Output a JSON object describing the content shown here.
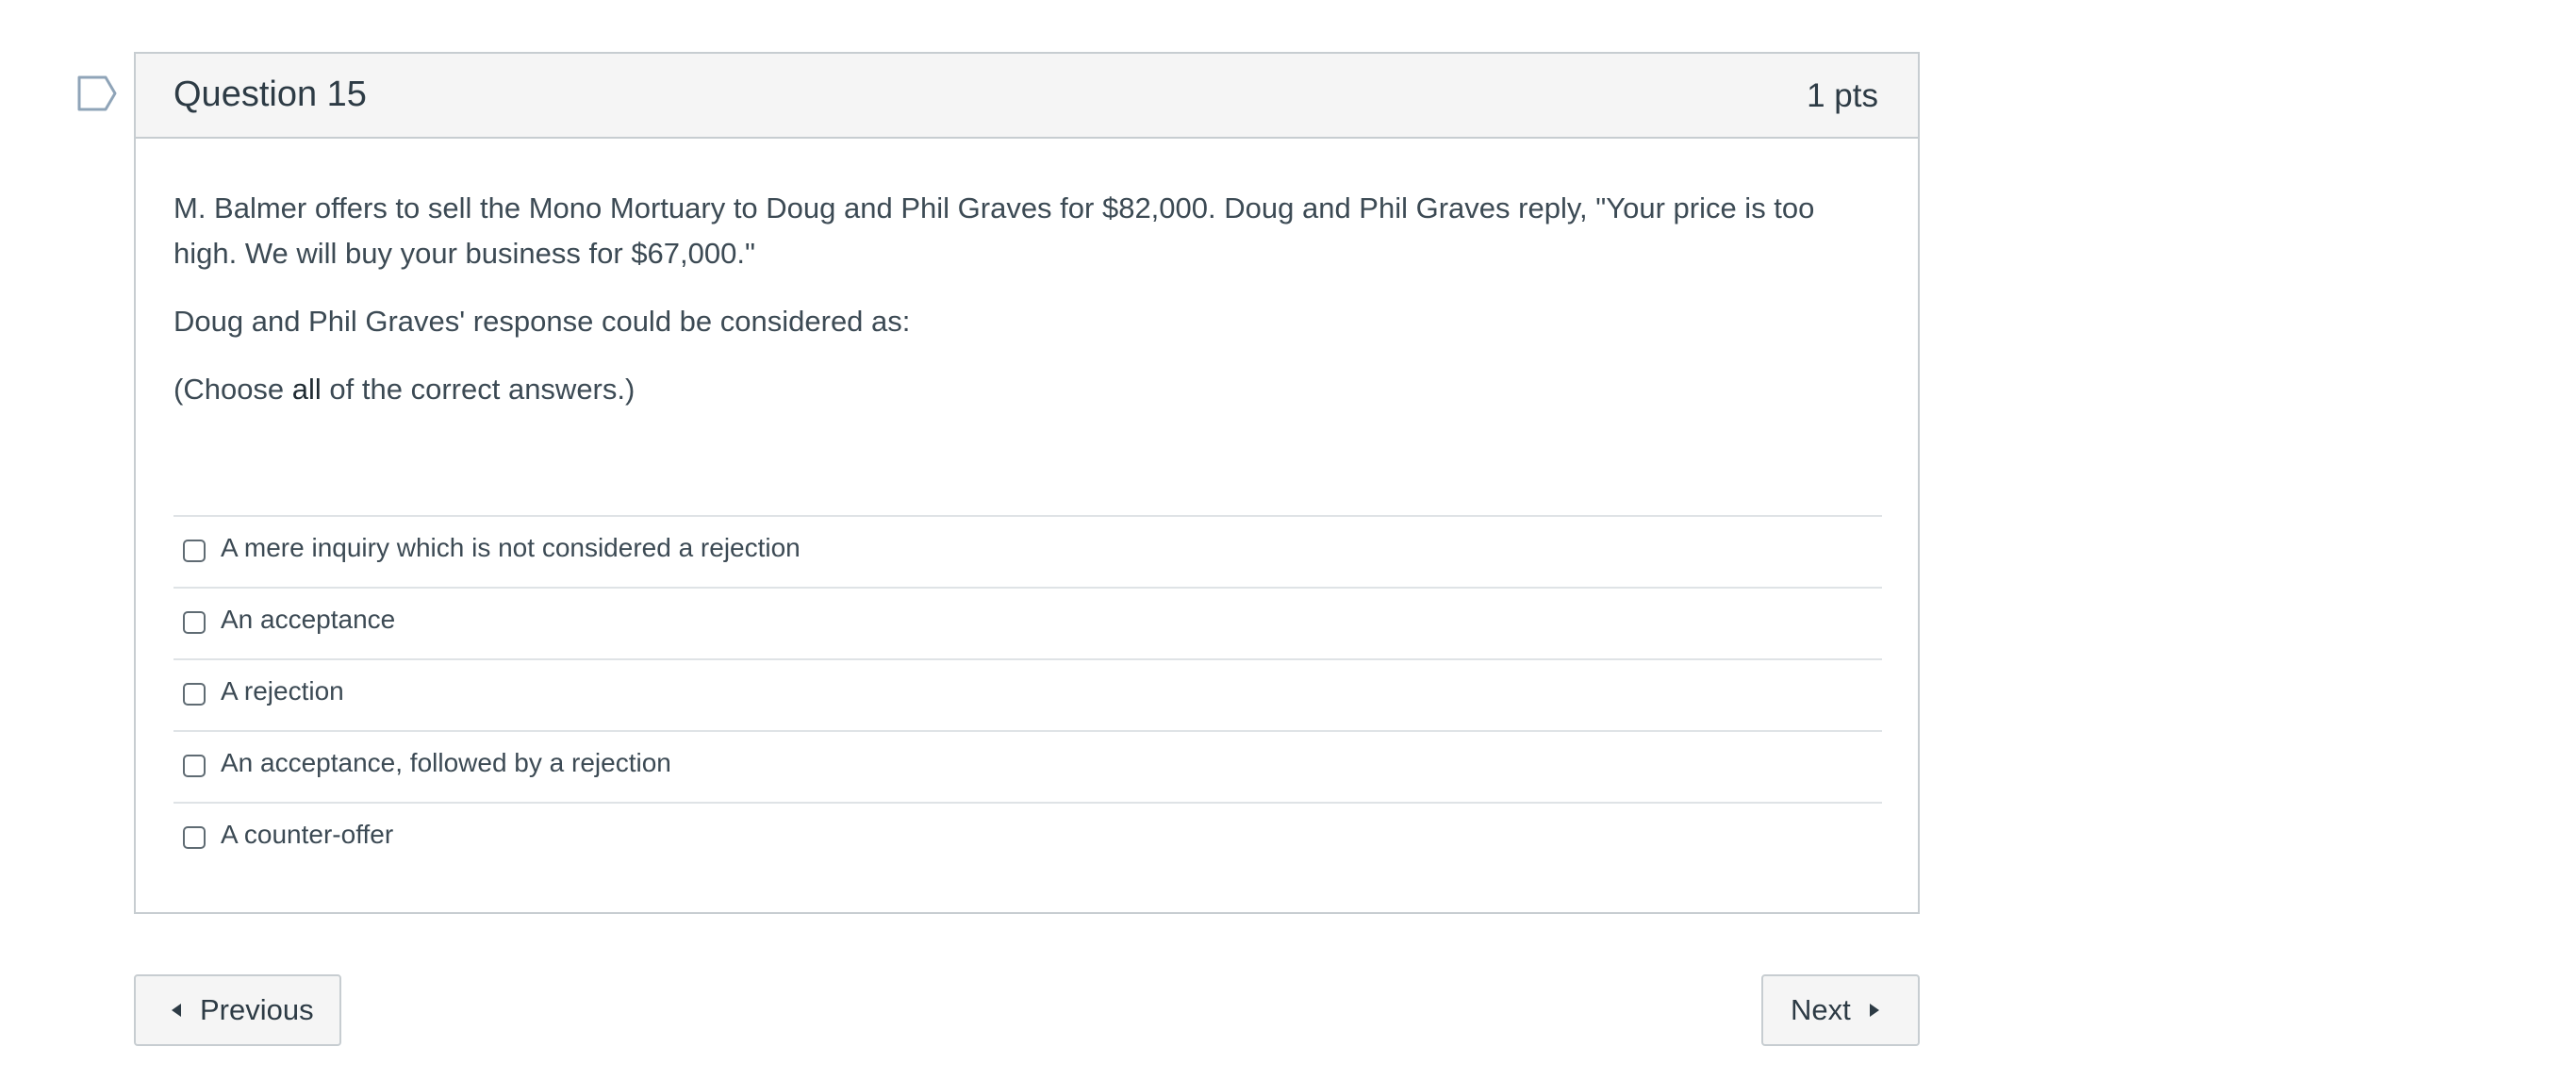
{
  "question": {
    "title": "Question 15",
    "points": "1 pts",
    "paragraph1": "M. Balmer offers to sell the Mono Mortuary to Doug and Phil Graves for $82,000.  Doug and Phil Graves reply, \"Your price is too high. We will buy your business for $67,000.\"",
    "paragraph2": "Doug and Phil Graves' response could be considered as:",
    "paragraph3_prefix": "(Choose ",
    "paragraph3_emphasis": "all",
    "paragraph3_suffix": " of the correct answers.)"
  },
  "answers": [
    {
      "label": "A mere inquiry which is not considered a rejection",
      "checked": false
    },
    {
      "label": "An acceptance",
      "checked": false
    },
    {
      "label": "A rejection",
      "checked": false
    },
    {
      "label": "An acceptance, followed by a rejection",
      "checked": false
    },
    {
      "label": "A counter-offer",
      "checked": false
    }
  ],
  "navigation": {
    "previous_label": "Previous",
    "next_label": "Next"
  },
  "icons": {
    "flag": "bookmark-flag-icon",
    "previous": "caret-left-icon",
    "next": "caret-right-icon"
  },
  "colors": {
    "header_background": "#f5f5f5",
    "border": "#c7cdd1",
    "text": "#2d3b45",
    "flag_stroke": "#8fa4b8"
  }
}
